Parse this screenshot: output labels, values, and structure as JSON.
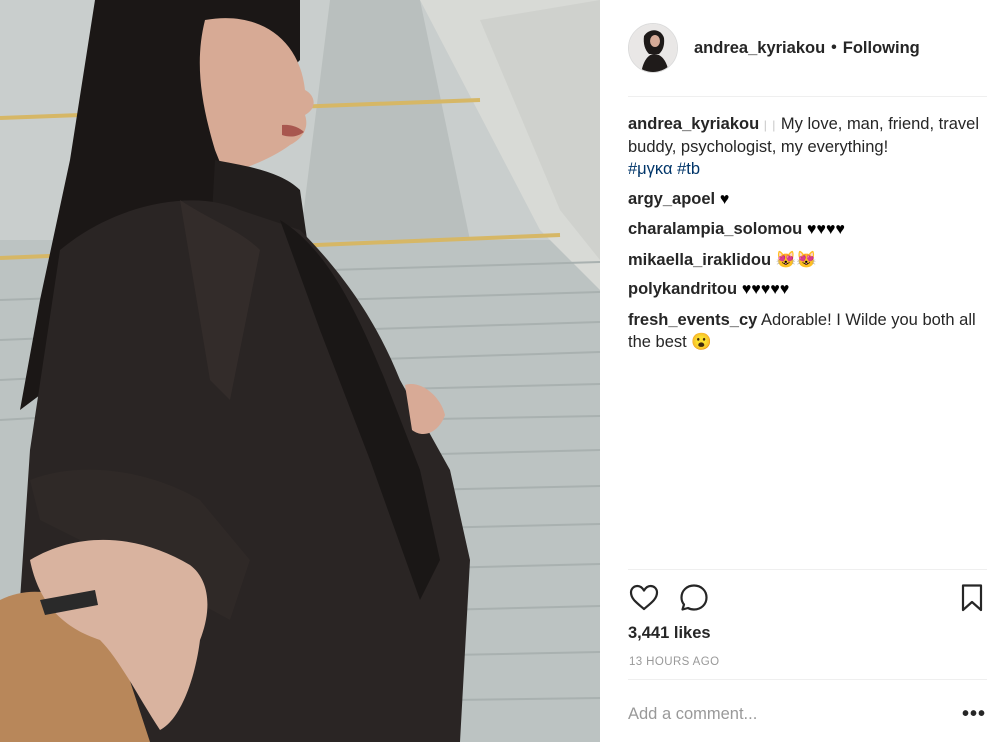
{
  "post": {
    "author": "andrea_kyriakou",
    "separator": "•",
    "follow_status": "Following",
    "photo_alt": "Woman in black coat on stairs, holding hand"
  },
  "comments": [
    {
      "user": "andrea_kyriakou",
      "prefix": "| |",
      "text": "My love, man, friend, travel buddy, psychologist, my everything!",
      "tags": [
        "#μγκα",
        "#tb"
      ]
    },
    {
      "user": "argy_apoel",
      "text": "♥"
    },
    {
      "user": "charalampia_solomou",
      "text": "♥♥♥♥"
    },
    {
      "user": "mikaella_iraklidou",
      "text": "😻😻"
    },
    {
      "user": "polykandritou",
      "text": "♥♥♥♥♥"
    },
    {
      "user": "fresh_events_cy",
      "text": "Adorable! I Wilde you both all the best 😮"
    }
  ],
  "actions": {
    "like_icon": "heart-outline-icon",
    "comment_icon": "speech-bubble-icon",
    "save_icon": "bookmark-icon"
  },
  "likes_label": "3,441 likes",
  "time_ago": "13 HOURS AGO",
  "add_comment_placeholder": "Add a comment...",
  "more_label": "•••",
  "colors": {
    "text": "#262626",
    "hashtag": "#003569",
    "muted": "#999999",
    "divider": "#efefef"
  }
}
